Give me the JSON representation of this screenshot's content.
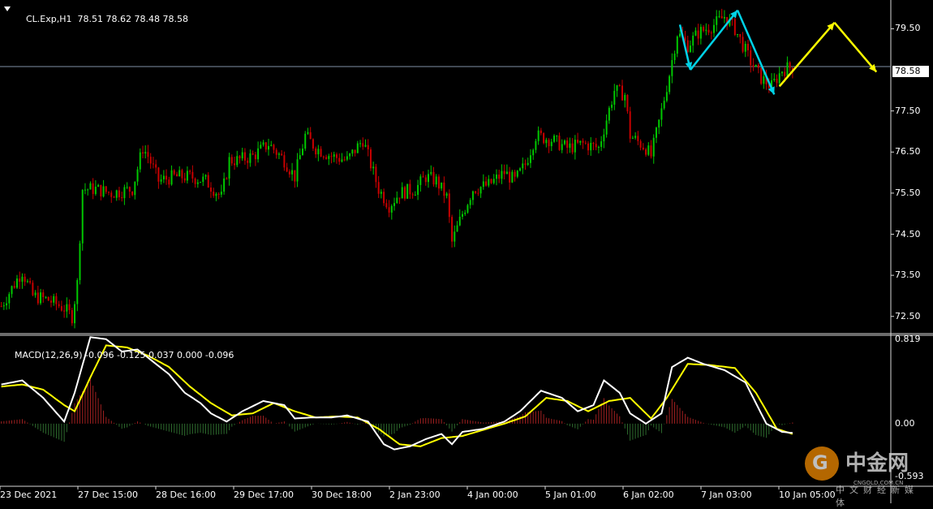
{
  "header": {
    "symbol": "CL.Exp,H1",
    "ohlc": "78.51 78.62 78.48 78.58",
    "last_price": "78.58"
  },
  "indicator": {
    "label": "MACD(12,26,9)",
    "values": "-0.096 -0.125 0.037 0.000 -0.096"
  },
  "watermark": {
    "name": "中金网",
    "domain": "CNGOLD.COM.CN",
    "subtitle": "中文财经新媒体"
  },
  "colors": {
    "background": "#000000",
    "bull": "#00c800",
    "bear": "#c80000",
    "macd_line": "#ffffff",
    "signal_line": "#ffff00",
    "arrows_cyan": "#00d2e6",
    "arrows_yellow": "#ffff00",
    "hist_pos": "#a02020",
    "hist_neg": "#2e6b2e"
  },
  "chart_data": [
    {
      "type": "candlestick",
      "timeframe": "H1",
      "ylim": [
        72.1,
        80.2
      ],
      "y_ticks": [
        "79.50",
        "78.58",
        "77.50",
        "76.50",
        "75.50",
        "74.50",
        "73.50",
        "72.50"
      ],
      "x_ticks": [
        "23 Dec 2021",
        "27 Dec 15:00",
        "28 Dec 16:00",
        "29 Dec 17:00",
        "30 Dec 18:00",
        "2 Jan 23:00",
        "4 Jan 00:00",
        "5 Jan 01:00",
        "6 Jan 02:00",
        "7 Jan 03:00",
        "10 Jan 05:00"
      ],
      "current_price": 78.58,
      "price_path": [
        [
          0,
          72.75
        ],
        [
          6,
          73.4
        ],
        [
          8,
          73.6
        ],
        [
          12,
          73.0
        ],
        [
          18,
          72.9
        ],
        [
          24,
          72.7
        ],
        [
          27,
          72.5
        ],
        [
          29,
          73.3
        ],
        [
          31,
          75.6
        ],
        [
          36,
          75.6
        ],
        [
          42,
          75.5
        ],
        [
          50,
          75.6
        ],
        [
          54,
          76.6
        ],
        [
          56,
          76.4
        ],
        [
          60,
          75.8
        ],
        [
          66,
          75.9
        ],
        [
          72,
          75.9
        ],
        [
          78,
          75.8
        ],
        [
          84,
          75.4
        ],
        [
          87,
          76.3
        ],
        [
          90,
          76.3
        ],
        [
          96,
          76.4
        ],
        [
          102,
          76.7
        ],
        [
          108,
          76.3
        ],
        [
          112,
          75.9
        ],
        [
          116,
          76.9
        ],
        [
          120,
          76.6
        ],
        [
          126,
          76.4
        ],
        [
          132,
          76.3
        ],
        [
          138,
          76.8
        ],
        [
          144,
          75.6
        ],
        [
          148,
          75.2
        ],
        [
          152,
          75.5
        ],
        [
          158,
          75.6
        ],
        [
          162,
          75.9
        ],
        [
          166,
          75.8
        ],
        [
          170,
          75.4
        ],
        [
          172,
          74.3
        ],
        [
          176,
          75.0
        ],
        [
          180,
          75.6
        ],
        [
          186,
          75.7
        ],
        [
          192,
          76.0
        ],
        [
          196,
          75.8
        ],
        [
          200,
          76.2
        ],
        [
          204,
          76.9
        ],
        [
          210,
          76.8
        ],
        [
          216,
          76.6
        ],
        [
          222,
          76.7
        ],
        [
          228,
          76.6
        ],
        [
          234,
          78.0
        ],
        [
          238,
          77.9
        ],
        [
          240,
          76.9
        ],
        [
          246,
          76.6
        ],
        [
          248,
          76.4
        ],
        [
          252,
          77.5
        ],
        [
          255,
          78.4
        ],
        [
          258,
          79.4
        ],
        [
          262,
          79.1
        ],
        [
          266,
          79.4
        ],
        [
          272,
          79.6
        ],
        [
          276,
          79.8
        ],
        [
          280,
          79.5
        ],
        [
          286,
          78.7
        ],
        [
          290,
          78.3
        ],
        [
          294,
          78.1
        ],
        [
          298,
          78.5
        ],
        [
          302,
          78.58
        ]
      ],
      "annotations": [
        {
          "color": "cyan",
          "points": [
            [
              259,
              79.6
            ],
            [
              263,
              78.5
            ]
          ]
        },
        {
          "color": "cyan",
          "points": [
            [
              263,
              78.5
            ],
            [
              281,
              79.95
            ]
          ]
        },
        {
          "color": "cyan",
          "points": [
            [
              281,
              79.95
            ],
            [
              295,
              77.9
            ]
          ]
        },
        {
          "color": "yellow",
          "points": [
            [
              297,
              78.1
            ],
            [
              318,
              79.65
            ]
          ]
        },
        {
          "color": "yellow",
          "points": [
            [
              318,
              79.65
            ],
            [
              334,
              78.45
            ]
          ]
        }
      ]
    },
    {
      "type": "line",
      "name": "MACD(12,26,9)",
      "ylim": [
        -0.6,
        0.85
      ],
      "y_ticks": [
        "0.819",
        "0.00",
        "-0.593"
      ],
      "series": [
        {
          "name": "MACD",
          "color": "white",
          "points": [
            [
              0,
              0.38
            ],
            [
              8,
              0.42
            ],
            [
              16,
              0.25
            ],
            [
              24,
              0.02
            ],
            [
              28,
              0.3
            ],
            [
              34,
              0.84
            ],
            [
              40,
              0.82
            ],
            [
              46,
              0.7
            ],
            [
              52,
              0.72
            ],
            [
              58,
              0.6
            ],
            [
              64,
              0.48
            ],
            [
              70,
              0.3
            ],
            [
              76,
              0.2
            ],
            [
              80,
              0.1
            ],
            [
              86,
              0.02
            ],
            [
              92,
              0.12
            ],
            [
              100,
              0.22
            ],
            [
              108,
              0.18
            ],
            [
              112,
              0.05
            ],
            [
              118,
              0.06
            ],
            [
              126,
              0.06
            ],
            [
              132,
              0.08
            ],
            [
              140,
              0.02
            ],
            [
              146,
              -0.2
            ],
            [
              150,
              -0.25
            ],
            [
              156,
              -0.22
            ],
            [
              162,
              -0.15
            ],
            [
              168,
              -0.1
            ],
            [
              172,
              -0.2
            ],
            [
              176,
              -0.08
            ],
            [
              184,
              -0.05
            ],
            [
              192,
              0.02
            ],
            [
              198,
              0.12
            ],
            [
              206,
              0.32
            ],
            [
              214,
              0.25
            ],
            [
              220,
              0.12
            ],
            [
              226,
              0.18
            ],
            [
              230,
              0.42
            ],
            [
              236,
              0.3
            ],
            [
              240,
              0.1
            ],
            [
              246,
              0.0
            ],
            [
              252,
              0.1
            ],
            [
              256,
              0.55
            ],
            [
              262,
              0.64
            ],
            [
              268,
              0.58
            ],
            [
              276,
              0.52
            ],
            [
              284,
              0.4
            ],
            [
              292,
              0.0
            ],
            [
              298,
              -0.08
            ],
            [
              302,
              -0.09
            ]
          ]
        },
        {
          "name": "Signal",
          "color": "yellow",
          "points": [
            [
              0,
              0.36
            ],
            [
              8,
              0.38
            ],
            [
              16,
              0.33
            ],
            [
              24,
              0.18
            ],
            [
              28,
              0.12
            ],
            [
              34,
              0.45
            ],
            [
              40,
              0.76
            ],
            [
              48,
              0.74
            ],
            [
              56,
              0.66
            ],
            [
              64,
              0.55
            ],
            [
              72,
              0.36
            ],
            [
              80,
              0.2
            ],
            [
              88,
              0.08
            ],
            [
              96,
              0.1
            ],
            [
              104,
              0.2
            ],
            [
              112,
              0.12
            ],
            [
              120,
              0.06
            ],
            [
              128,
              0.07
            ],
            [
              136,
              0.06
            ],
            [
              144,
              -0.05
            ],
            [
              152,
              -0.2
            ],
            [
              160,
              -0.22
            ],
            [
              168,
              -0.14
            ],
            [
              176,
              -0.12
            ],
            [
              184,
              -0.06
            ],
            [
              192,
              0.0
            ],
            [
              200,
              0.07
            ],
            [
              208,
              0.25
            ],
            [
              216,
              0.22
            ],
            [
              224,
              0.12
            ],
            [
              232,
              0.22
            ],
            [
              240,
              0.25
            ],
            [
              248,
              0.05
            ],
            [
              254,
              0.25
            ],
            [
              262,
              0.58
            ],
            [
              270,
              0.57
            ],
            [
              280,
              0.54
            ],
            [
              288,
              0.3
            ],
            [
              296,
              -0.05
            ],
            [
              302,
              -0.1
            ]
          ]
        }
      ]
    }
  ]
}
